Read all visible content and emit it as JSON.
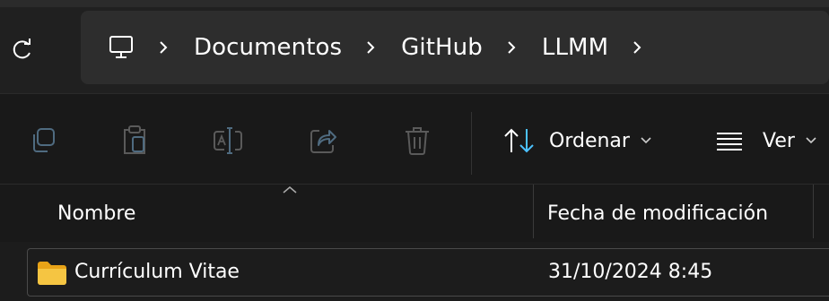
{
  "address_bar": {
    "crumbs": [
      "Documentos",
      "GitHub",
      "LLMM"
    ]
  },
  "toolbar": {
    "sort_label": "Ordenar",
    "view_label": "Ver"
  },
  "columns": {
    "name": "Nombre",
    "date": "Fecha de modificación"
  },
  "files": [
    {
      "name": "Currículum Vitae",
      "modified": "31/10/2024 8:45",
      "type": "folder"
    }
  ],
  "colors": {
    "folder": "#f5c542",
    "accent": "#4cc2ff"
  }
}
